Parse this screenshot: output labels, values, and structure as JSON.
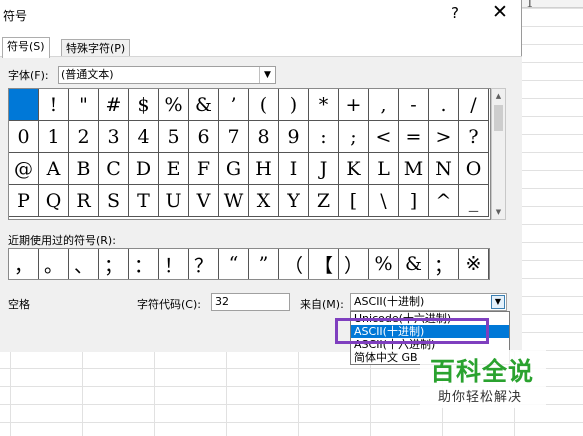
{
  "dialog": {
    "title": "符号",
    "help_label": "?",
    "close_label": "✕"
  },
  "tabs": [
    {
      "label": "符号(S)"
    },
    {
      "label": "特殊字符(P)"
    }
  ],
  "font": {
    "label": "字体(F):",
    "value": "(普通文本)"
  },
  "symbols": [
    " ",
    "!",
    "\"",
    "#",
    "$",
    "%",
    "&",
    "’",
    "(",
    ")",
    "*",
    "+",
    ",",
    "-",
    ".",
    "/",
    "0",
    "1",
    "2",
    "3",
    "4",
    "5",
    "6",
    "7",
    "8",
    "9",
    ":",
    ";",
    "<",
    "=",
    ">",
    "?",
    "@",
    "A",
    "B",
    "C",
    "D",
    "E",
    "F",
    "G",
    "H",
    "I",
    "J",
    "K",
    "L",
    "M",
    "N",
    "O",
    "P",
    "Q",
    "R",
    "S",
    "T",
    "U",
    "V",
    "W",
    "X",
    "Y",
    "Z",
    "[",
    "\\",
    "]",
    "^",
    "_"
  ],
  "recent": {
    "label": "近期使用过的符号(R):",
    "symbols": [
      "，",
      "。",
      "、",
      "；",
      "：",
      "！",
      "？",
      "“",
      "”",
      "（",
      "【",
      "）",
      "%",
      "&",
      "；",
      "※"
    ]
  },
  "char_name": "空格",
  "char_code": {
    "label": "字符代码(C):",
    "value": "32"
  },
  "from": {
    "label": "来自(M):",
    "value": "ASCII(十进制)",
    "options": [
      "Unicode(十六进制)",
      "ASCII(十进制)",
      "ASCII(十六进制)",
      "简体中文 GB"
    ]
  },
  "spreadsheet": {
    "column_header": "1"
  },
  "watermark": {
    "title": "百科全说",
    "subtitle": "助你轻松解决"
  },
  "colors": {
    "selection": "#0078d7",
    "highlight_box": "#7f3fbf",
    "watermark_green": "#2aa22f"
  }
}
